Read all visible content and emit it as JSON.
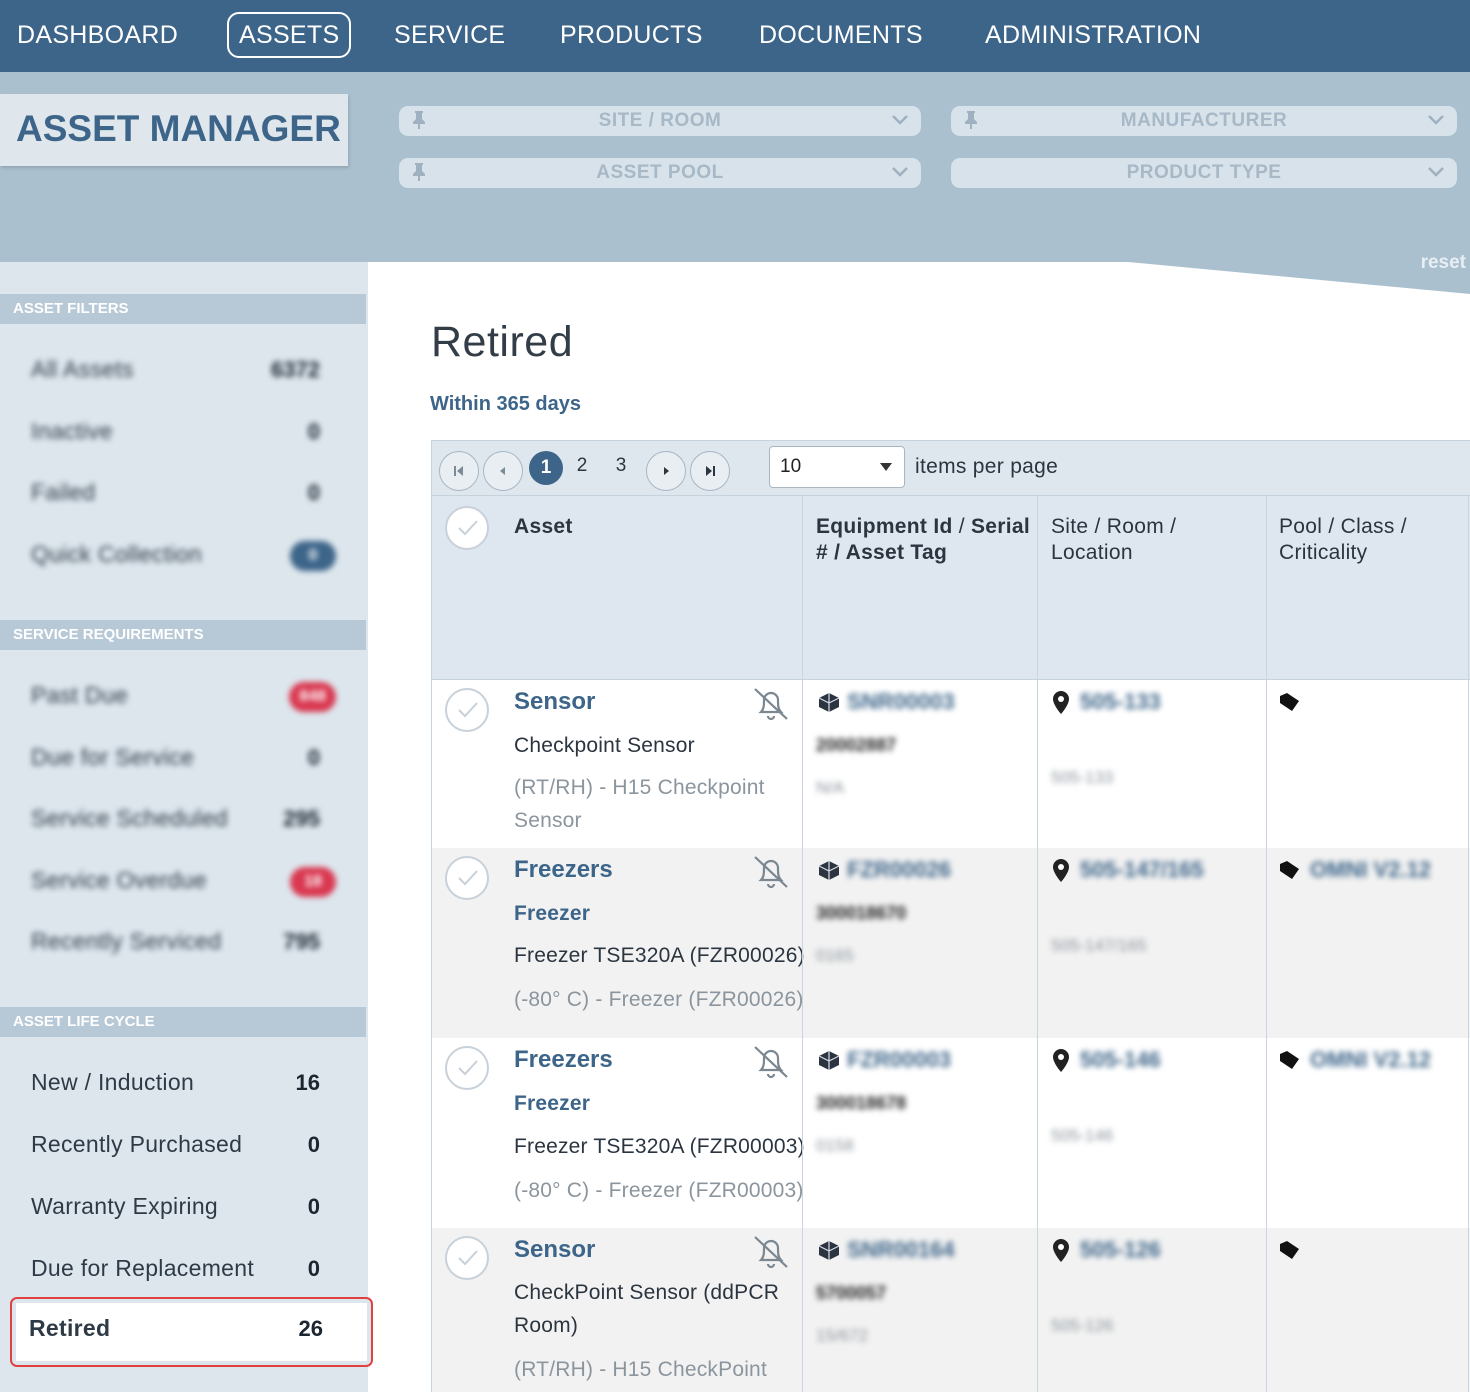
{
  "nav": {
    "items": [
      "DASHBOARD",
      "ASSETS",
      "SERVICE",
      "PRODUCTS",
      "DOCUMENTS",
      "ADMINISTRATION"
    ],
    "active": "ASSETS"
  },
  "header": {
    "title": "ASSET MANAGER",
    "filters": {
      "site_room": "SITE / ROOM",
      "manufacturer": "MANUFACTURER",
      "asset_pool": "ASSET POOL",
      "product_type": "PRODUCT TYPE"
    },
    "reset": "reset"
  },
  "sidebar": {
    "asset_filters": {
      "heading": "ASSET FILTERS",
      "items": [
        {
          "label": "All Assets",
          "count": "6372"
        },
        {
          "label": "Inactive",
          "count": "0"
        },
        {
          "label": "Failed",
          "count": "0"
        },
        {
          "label": "Quick Collection",
          "count": "0"
        }
      ]
    },
    "service_requirements": {
      "heading": "SERVICE REQUIREMENTS",
      "items": [
        {
          "label": "Past Due",
          "count": "848"
        },
        {
          "label": "Due for Service",
          "count": "0"
        },
        {
          "label": "Service Scheduled",
          "count": "295"
        },
        {
          "label": "Service Overdue",
          "count": "18"
        },
        {
          "label": "Recently Serviced",
          "count": "795"
        }
      ]
    },
    "asset_life_cycle": {
      "heading": "ASSET LIFE CYCLE",
      "items": [
        {
          "label": "New / Induction",
          "count": "16"
        },
        {
          "label": "Recently Purchased",
          "count": "0"
        },
        {
          "label": "Warranty Expiring",
          "count": "0"
        },
        {
          "label": "Due for Replacement",
          "count": "0"
        },
        {
          "label": "Retired",
          "count": "26"
        }
      ]
    }
  },
  "main": {
    "title": "Retired",
    "subtitle": "Within 365 days",
    "pager": {
      "pages": [
        "1",
        "2",
        "3"
      ],
      "current": "1",
      "per_page": "10",
      "per_page_label": "items per page"
    },
    "columns": {
      "asset": "Asset",
      "equipment_a": "Equipment Id",
      "equipment_b": "Serial",
      "equipment_c": "# / Asset Tag",
      "site_a": "Site / Room /",
      "site_b": "Location",
      "pool_a": "Pool / Class /",
      "pool_b": "Criticality"
    },
    "rows": [
      {
        "title": "Sensor",
        "lines": [
          "Checkpoint Sensor",
          "(RT/RH) - H15 Checkpoint",
          "Sensor"
        ],
        "equipment_id": "SNR00003",
        "serial": "20002887",
        "tag": "N/A",
        "site": "505-133",
        "location": "505-133",
        "pool": ""
      },
      {
        "title": "Freezers",
        "category": "Freezer",
        "lines": [
          "Freezer TSE320A (FZR00026)",
          "(-80° C) - Freezer (FZR00026)"
        ],
        "equipment_id": "FZR00026",
        "serial": "300018670",
        "tag": "0165",
        "site": "505-147/165",
        "location": "505-147/165",
        "pool": "OMNI V2.12"
      },
      {
        "title": "Freezers",
        "category": "Freezer",
        "lines": [
          "Freezer TSE320A (FZR00003)",
          "(-80° C) - Freezer (FZR00003)"
        ],
        "equipment_id": "FZR00003",
        "serial": "300018678",
        "tag": "0158",
        "site": "505-146",
        "location": "505-146",
        "pool": "OMNI V2.12"
      },
      {
        "title": "Sensor",
        "lines": [
          "CheckPoint Sensor (ddPCR",
          "Room)",
          "(RT/RH) - H15 CheckPoint"
        ],
        "equipment_id": "SNR00164",
        "serial": "5700057",
        "tag": "15/672",
        "site": "505-126",
        "location": "505-126",
        "pool": ""
      }
    ]
  },
  "colors": {
    "nav_bg": "#3d6589",
    "header_bg": "#aac0cf",
    "sidebar_bg": "#dde6ed",
    "accent": "#3d6589",
    "danger": "#d93850",
    "highlight_border": "#e0423f"
  }
}
